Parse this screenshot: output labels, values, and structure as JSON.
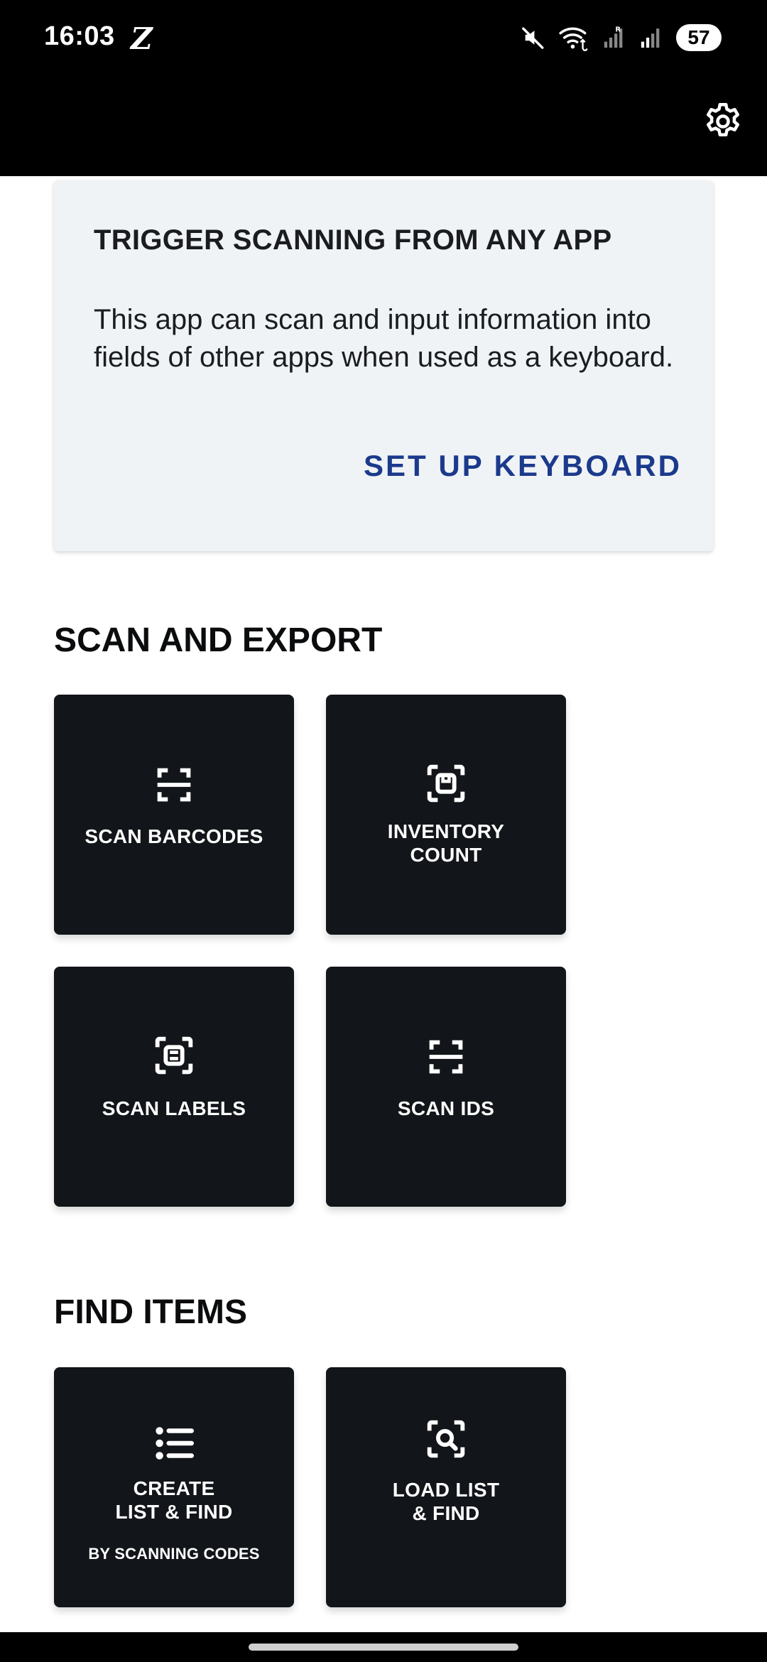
{
  "status": {
    "time": "16:03",
    "carrier_glyph": "Z",
    "battery": "57",
    "icons": [
      "mute-icon",
      "wifi-icon",
      "signal-icon",
      "signal-icon"
    ]
  },
  "header": {
    "settings_icon": "gear-icon"
  },
  "keyboard_card": {
    "title": "TRIGGER SCANNING FROM ANY APP",
    "body": "This app can scan and input information into fields of other apps when used as a keyboard.",
    "action": "SET UP KEYBOARD"
  },
  "sections": {
    "scan_export": {
      "title": "SCAN AND EXPORT",
      "tiles": [
        {
          "label": "SCAN BARCODES",
          "icon": "barcode-scan-icon"
        },
        {
          "label_line1": "INVENTORY",
          "label_line2": "COUNT",
          "icon": "box-scan-icon"
        },
        {
          "label": "SCAN LABELS",
          "icon": "label-scan-icon"
        },
        {
          "label": "SCAN IDS",
          "icon": "id-scan-icon"
        }
      ]
    },
    "find_items": {
      "title": "FIND ITEMS",
      "tiles": [
        {
          "label_line1": "CREATE",
          "label_line2": "LIST & FIND",
          "sub": "BY SCANNING CODES",
          "icon": "list-icon"
        },
        {
          "label_line1": "LOAD LIST",
          "label_line2": "& FIND",
          "icon": "search-scan-icon"
        }
      ]
    }
  },
  "colors": {
    "accent": "#1b3a8c",
    "tile_bg": "#121519",
    "card_bg": "#f0f3f6"
  }
}
